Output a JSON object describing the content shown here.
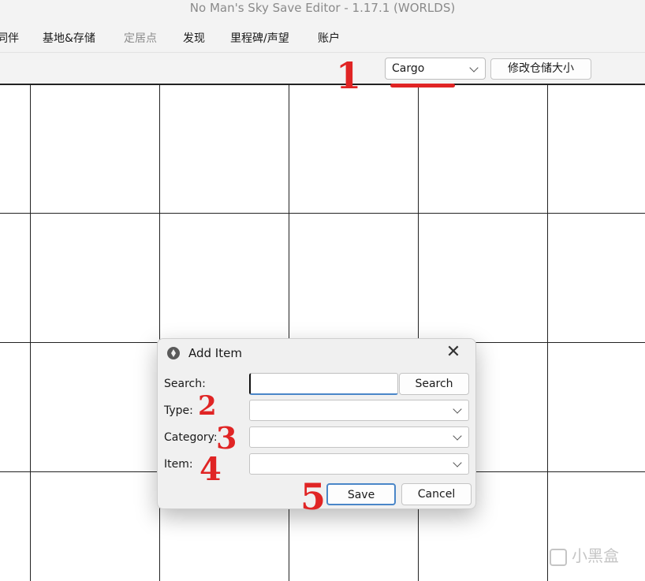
{
  "window": {
    "title": "No Man's Sky Save Editor - 1.17.1 (WORLDS)"
  },
  "menu": {
    "items": [
      {
        "label": "同伴",
        "disabled": false
      },
      {
        "label": "基地&存储",
        "disabled": false
      },
      {
        "label": "定居点",
        "disabled": true
      },
      {
        "label": "发现",
        "disabled": false
      },
      {
        "label": "里程碑/声望",
        "disabled": false
      },
      {
        "label": "账户",
        "disabled": false
      }
    ]
  },
  "toolbar": {
    "inventory_select": {
      "value": "Cargo"
    },
    "resize_button": "修改仓储大小"
  },
  "dialog": {
    "title": "Add Item",
    "search_label": "Search:",
    "search_value": "",
    "search_button": "Search",
    "type_label": "Type:",
    "type_value": "",
    "category_label": "Category:",
    "category_value": "",
    "item_label": "Item:",
    "item_value": "",
    "save_button": "Save",
    "cancel_button": "Cancel",
    "close_glyph": "✕"
  },
  "annotations": [
    "1",
    "2",
    "3",
    "4",
    "5"
  ],
  "watermark": {
    "text": "小黑盒"
  },
  "colors": {
    "annotation": "#e02424",
    "focus_accent": "#4a86c8",
    "chrome_bg": "#f3f3f3"
  },
  "icons": [
    "app-icon",
    "close-icon",
    "chevron-down-icon"
  ]
}
